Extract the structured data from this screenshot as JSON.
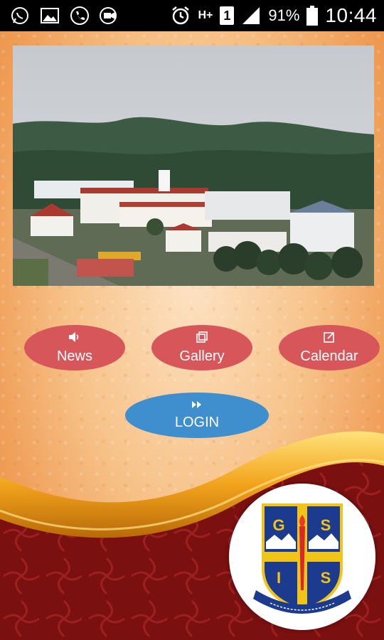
{
  "status_bar": {
    "icons_left": [
      "whatsapp-icon",
      "gallery-icon",
      "phone-icon",
      "video-camera-icon"
    ],
    "icons_right": [
      "alarm-icon",
      "data-arrows-icon",
      "sim-icon",
      "signal-icon",
      "battery-icon"
    ],
    "network_label": "H+",
    "sim_number": "1",
    "battery": "91%",
    "time": "10:44"
  },
  "hero": {
    "image": "school-campus-photo"
  },
  "buttons": {
    "news": {
      "label": "News",
      "icon": "speaker-icon"
    },
    "gallery": {
      "label": "Gallery",
      "icon": "gallery-squares-icon"
    },
    "calendar": {
      "label": "Calendar",
      "icon": "edit-calendar-icon"
    },
    "login": {
      "label": "LOGIN",
      "icon": "fast-forward-icon"
    }
  },
  "logo": {
    "letters": [
      "G",
      "S",
      "I",
      "S"
    ]
  },
  "colors": {
    "button_red": "#d6565a",
    "button_blue": "#3f8fcf",
    "wave_gold": "#f2b52e",
    "wave_maroon": "#7a1010"
  }
}
